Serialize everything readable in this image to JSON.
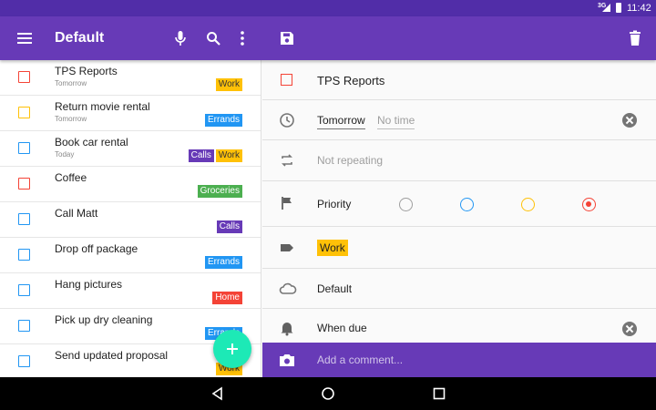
{
  "status": {
    "time": "11:42",
    "signal": "3G"
  },
  "appbar": {
    "title": "Default"
  },
  "tasks": [
    {
      "title": "TPS Reports",
      "due": "Tomorrow",
      "checkbox_color": "#f44336",
      "tags": [
        {
          "label": "Work",
          "color": "#ffc107"
        }
      ]
    },
    {
      "title": "Return movie rental",
      "due": "Tomorrow",
      "checkbox_color": "#ffc107",
      "tags": [
        {
          "label": "Errands",
          "color": "#2196f3"
        }
      ]
    },
    {
      "title": "Book car rental",
      "due": "Today",
      "checkbox_color": "#2196f3",
      "tags": [
        {
          "label": "Calls",
          "color": "#673ab7"
        },
        {
          "label": "Work",
          "color": "#ffc107"
        }
      ]
    },
    {
      "title": "Coffee",
      "due": "",
      "checkbox_color": "#f44336",
      "tags": [
        {
          "label": "Groceries",
          "color": "#4caf50"
        }
      ]
    },
    {
      "title": "Call Matt",
      "due": "",
      "checkbox_color": "#2196f3",
      "tags": [
        {
          "label": "Calls",
          "color": "#673ab7"
        }
      ]
    },
    {
      "title": "Drop off package",
      "due": "",
      "checkbox_color": "#2196f3",
      "tags": [
        {
          "label": "Errands",
          "color": "#2196f3"
        }
      ]
    },
    {
      "title": "Hang pictures",
      "due": "",
      "checkbox_color": "#2196f3",
      "tags": [
        {
          "label": "Home",
          "color": "#f44336"
        }
      ]
    },
    {
      "title": "Pick up dry cleaning",
      "due": "",
      "checkbox_color": "#2196f3",
      "tags": [
        {
          "label": "Errands",
          "color": "#2196f3"
        }
      ]
    },
    {
      "title": "Send updated proposal",
      "due": "",
      "checkbox_color": "#2196f3",
      "tags": [
        {
          "label": "Work",
          "color": "#ffc107"
        }
      ]
    }
  ],
  "detail": {
    "title": "TPS Reports",
    "title_checkbox_color": "#f44336",
    "due_date": "Tomorrow",
    "due_time": "No time",
    "repeat": "Not repeating",
    "priority_label": "Priority",
    "priority_colors": [
      "#9e9e9e",
      "#2196f3",
      "#ffc107",
      "#f44336"
    ],
    "selected_priority": "high",
    "tag": {
      "label": "Work",
      "color": "#ffc107"
    },
    "list": "Default",
    "reminder": "When due",
    "comment_placeholder": "Add a comment..."
  },
  "colors": {
    "primary": "#673ab7",
    "primary_dark": "#512da8",
    "accent": "#1de9b6"
  }
}
